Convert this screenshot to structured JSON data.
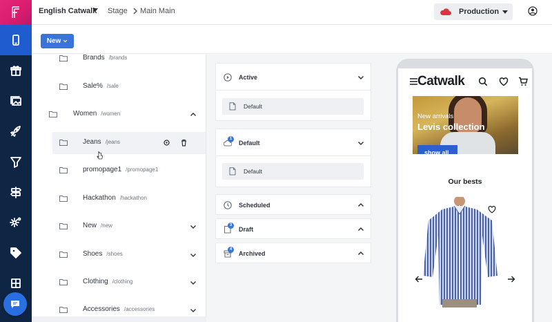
{
  "topbar": {
    "space_name": "English Catwalk",
    "breadcrumb": [
      "Stage",
      "Main Main"
    ],
    "environment": "Production"
  },
  "toolbar": {
    "new_label": "New"
  },
  "tree": {
    "items": [
      {
        "name": "Brands",
        "path": "/brands",
        "indent": 1,
        "chevron": ""
      },
      {
        "name": "Sale%",
        "path": "/sale",
        "indent": 1,
        "chevron": ""
      },
      {
        "name": "Women",
        "path": "/women",
        "indent": 0,
        "chevron": "up"
      },
      {
        "name": "Jeans",
        "path": "/jeans",
        "indent": 1,
        "chevron": "",
        "selected": true
      },
      {
        "name": "promopage1",
        "path": "/promopage1",
        "indent": 1,
        "chevron": ""
      },
      {
        "name": "Hackathon",
        "path": "/hackathon",
        "indent": 1,
        "chevron": ""
      },
      {
        "name": "New",
        "path": "/new",
        "indent": 1,
        "chevron": "down"
      },
      {
        "name": "Shoes",
        "path": "/shoes",
        "indent": 1,
        "chevron": "down"
      },
      {
        "name": "Clothing",
        "path": "/clothing",
        "indent": 1,
        "chevron": "down"
      },
      {
        "name": "Accessories",
        "path": "/accessories",
        "indent": 1,
        "chevron": "down"
      }
    ]
  },
  "versions": {
    "active": {
      "label": "Active",
      "variant": "Default"
    },
    "default": {
      "label": "Default",
      "badge": "1",
      "variant": "Default"
    },
    "scheduled": {
      "label": "Scheduled"
    },
    "draft": {
      "label": "Draft",
      "badge": "3"
    },
    "archived": {
      "label": "Archived",
      "badge": "4"
    }
  },
  "preview": {
    "logo": "Catwalk",
    "banner_subtitle": "New arrivals",
    "banner_title": "Levis collection",
    "banner_cta": "show all",
    "section_title": "Our bests"
  },
  "colors": {
    "rail": "#0f2544",
    "rail_active": "#1e5ccf",
    "accent": "#3a74d9",
    "logo_pink": "#e52879",
    "production_cloud": "#d9343f"
  }
}
